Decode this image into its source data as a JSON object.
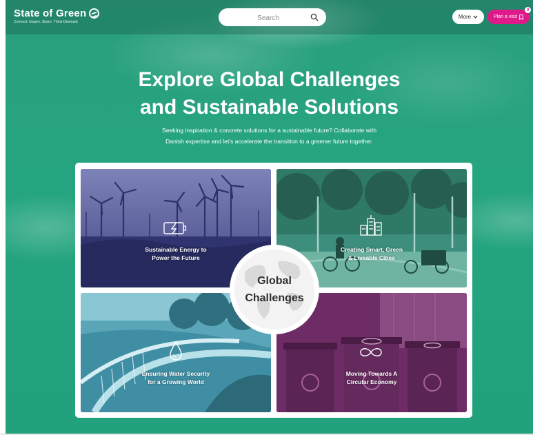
{
  "header": {
    "logo_title": "State of Green",
    "logo_tagline": "Connect. Inspire. Share. Think Denmark",
    "search_placeholder": "Search",
    "more_label": "More",
    "plan_visit_label": "Plan a visit",
    "plan_visit_count": "0"
  },
  "hero": {
    "title_line1": "Explore Global Challenges",
    "title_line2": "and Sustainable Solutions",
    "subtitle_line1": "Seeking inspiration & concrete solutions for a sustainable future? Collaborate with",
    "subtitle_line2": "Danish expertise and let's accelerate the transition to a greener future together."
  },
  "challenges": {
    "center_line1": "Global",
    "center_line2": "Challenges",
    "tiles": [
      {
        "line1": "Sustainable Energy to",
        "line2": "Power the Future",
        "icon": "battery-charge-icon",
        "color": "#4b4f8c"
      },
      {
        "line1": "Creating Smart, Green",
        "line2": "& Liveable Cities",
        "icon": "city-buildings-icon",
        "color": "#2a7a6a"
      },
      {
        "line1": "Ensuring Water Security",
        "line2": "for a Growing World",
        "icon": "water-drop-icon",
        "color": "#3a8fa4"
      },
      {
        "line1": "Moving Towards A",
        "line2": "Circular Economy",
        "icon": "infinity-loop-icon",
        "color": "#7a2a6e"
      }
    ]
  },
  "colors": {
    "brand_green": "#21a27c",
    "accent_pink": "#e0198a"
  }
}
